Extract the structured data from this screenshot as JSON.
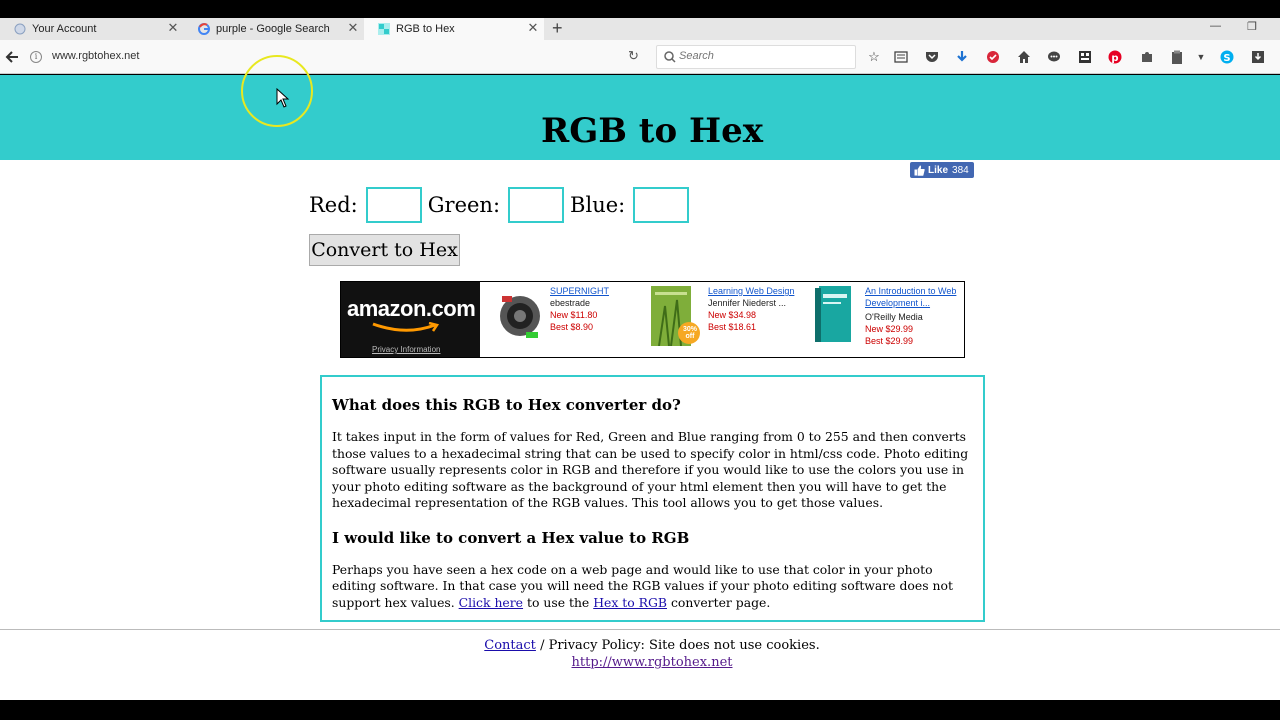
{
  "browser": {
    "tabs": [
      {
        "label": "Your Account"
      },
      {
        "label": "purple - Google Search"
      },
      {
        "label": "RGB to Hex"
      }
    ],
    "url": "www.rgbtohex.net",
    "search_placeholder": "Search"
  },
  "page": {
    "title": "RGB to Hex",
    "like": {
      "label": "Like",
      "count": "384"
    },
    "form": {
      "red_label": "Red:",
      "green_label": "Green:",
      "blue_label": "Blue:",
      "red_value": "",
      "green_value": "",
      "blue_value": "",
      "convert_label": "Convert to Hex"
    },
    "ad": {
      "logo": "amazon.com",
      "privacy": "Privacy Information",
      "items": [
        {
          "title": "SUPERNIGHT",
          "author": "ebestrade",
          "new": "New $11.80",
          "best": "Best $8.90"
        },
        {
          "title": "Learning Web Design",
          "author": "Jennifer Niederst ...",
          "new": "New $34.98",
          "best": "Best $18.61"
        },
        {
          "title": "An Introduction to Web",
          "title2": "Development i...",
          "author": "O'Reilly Media",
          "new": "New $29.99",
          "best": "Best $29.99"
        }
      ],
      "badge": "30% off"
    },
    "info": {
      "h1": "What does this RGB to Hex converter do?",
      "p1": "It takes input in the form of values for Red, Green and Blue ranging from 0 to 255 and then converts those values to a hexadecimal string that can be used to specify color in html/css code. Photo editing software usually represents color in RGB and therefore if you would like to use the colors you use in your photo editing software as the background of your html element then you will have to get the hexadecimal representation of the RGB values. This tool allows you to get those values.",
      "h2": "I would like to convert a Hex value to RGB",
      "p2_a": "Perhaps you have seen a hex code on a web page and would like to use that color in your photo editing software. In that case you will need the RGB values if your photo editing software does not support hex values.",
      "p2_link1": "Click here",
      "p2_b": "to use the",
      "p2_link2": "Hex to RGB",
      "p2_c": "converter page."
    },
    "footer": {
      "contact": "Contact",
      "policy": "/ Privacy Policy: Site does not use cookies.",
      "site": "http://www.rgbtohex.net"
    }
  },
  "colors": {
    "accent": "#33cccc",
    "facebook": "#4267b2",
    "link": "#1a0dab"
  }
}
